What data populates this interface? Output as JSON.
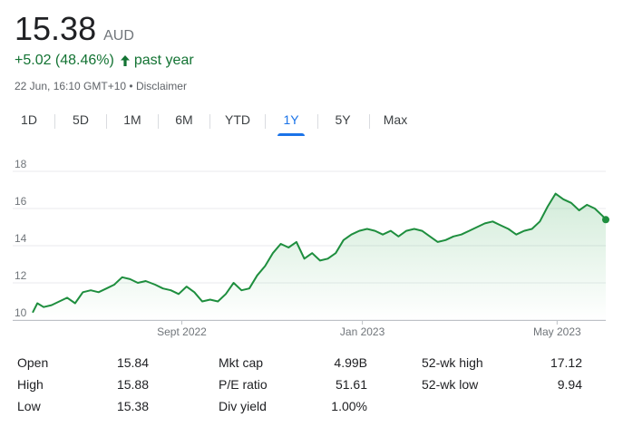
{
  "quote": {
    "price": "15.38",
    "currency": "AUD",
    "change": "+5.02 (48.46%)",
    "period": "past year",
    "timestamp": "22 Jun, 16:10 GMT+10",
    "separator": "•",
    "disclaimer": "Disclaimer",
    "positive_color": "#137333"
  },
  "tabs": [
    {
      "label": "1D",
      "active": false
    },
    {
      "label": "5D",
      "active": false
    },
    {
      "label": "1M",
      "active": false
    },
    {
      "label": "6M",
      "active": false
    },
    {
      "label": "YTD",
      "active": false
    },
    {
      "label": "1Y",
      "active": true
    },
    {
      "label": "5Y",
      "active": false
    },
    {
      "label": "Max",
      "active": false
    }
  ],
  "chart_data": {
    "type": "area",
    "ylim": [
      10,
      18
    ],
    "yticks": [
      "18",
      "16",
      "14",
      "12",
      "10"
    ],
    "ytick_values": [
      18,
      16,
      14,
      12,
      10
    ],
    "xticks": [
      "Sept 2022",
      "Jan 2023",
      "May 2023"
    ],
    "xtick_positions": [
      95,
      210,
      334
    ],
    "x_start": "2022-06-22",
    "x_end": "2023-06-22",
    "line_color": "#1e8e3e",
    "grid": true,
    "series": [
      {
        "x": [
          0,
          3,
          7,
          12,
          17,
          22,
          27,
          32,
          37,
          42,
          47,
          52,
          57,
          62,
          67,
          72,
          78,
          83,
          88,
          93,
          98,
          103,
          108,
          113,
          118,
          123,
          128,
          133,
          138,
          143,
          148,
          153,
          158,
          163,
          168,
          173,
          178,
          183,
          188,
          193,
          198,
          203,
          208,
          213,
          218,
          223,
          228,
          233,
          238,
          243,
          248,
          253,
          258,
          263,
          268,
          273,
          278,
          283,
          288,
          293,
          298,
          303,
          308,
          313,
          318,
          323,
          328,
          333,
          338,
          343,
          348,
          353,
          358,
          363,
          365
        ],
        "values": [
          10.4,
          10.9,
          10.7,
          10.8,
          11.0,
          11.2,
          10.9,
          11.5,
          11.6,
          11.5,
          11.7,
          11.9,
          12.3,
          12.2,
          12.0,
          12.1,
          11.9,
          11.7,
          11.6,
          11.4,
          11.8,
          11.5,
          11.0,
          11.1,
          11.0,
          11.4,
          12.0,
          11.6,
          11.7,
          12.4,
          12.9,
          13.6,
          14.1,
          13.9,
          14.2,
          13.3,
          13.6,
          13.2,
          13.3,
          13.6,
          14.3,
          14.6,
          14.8,
          14.9,
          14.8,
          14.6,
          14.8,
          14.5,
          14.8,
          14.9,
          14.8,
          14.5,
          14.2,
          14.3,
          14.5,
          14.6,
          14.8,
          15.0,
          15.2,
          15.3,
          15.1,
          14.9,
          14.6,
          14.8,
          14.9,
          15.3,
          16.1,
          16.8,
          16.5,
          16.3,
          15.9,
          16.2,
          16.0,
          15.6,
          15.4
        ]
      }
    ]
  },
  "stats": {
    "rows": [
      [
        {
          "label": "Open",
          "value": "15.84"
        },
        {
          "label": "Mkt cap",
          "value": "4.99B"
        },
        {
          "label": "52-wk high",
          "value": "17.12"
        }
      ],
      [
        {
          "label": "High",
          "value": "15.88"
        },
        {
          "label": "P/E ratio",
          "value": "51.61"
        },
        {
          "label": "52-wk low",
          "value": "9.94"
        }
      ],
      [
        {
          "label": "Low",
          "value": "15.38"
        },
        {
          "label": "Div yield",
          "value": "1.00%"
        },
        {
          "label": "",
          "value": ""
        }
      ]
    ]
  }
}
